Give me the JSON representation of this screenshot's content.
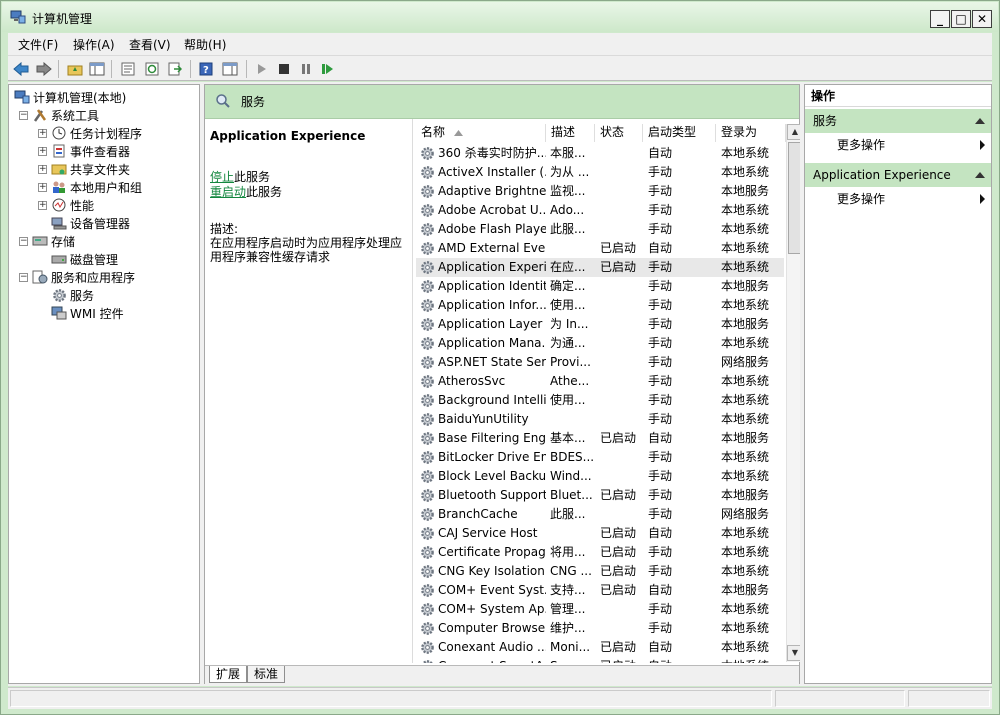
{
  "window": {
    "title": "计算机管理"
  },
  "menu": [
    "文件(F)",
    "操作(A)",
    "查看(V)",
    "帮助(H)"
  ],
  "tree": [
    {
      "label": "计算机管理(本地)",
      "level": 0,
      "icon": "computer-icon",
      "expander": ""
    },
    {
      "label": "系统工具",
      "level": 1,
      "icon": "tools-icon",
      "expander": "⊟"
    },
    {
      "label": "任务计划程序",
      "level": 2,
      "icon": "clock-icon",
      "expander": "+"
    },
    {
      "label": "事件查看器",
      "level": 2,
      "icon": "event-viewer-icon",
      "expander": "+"
    },
    {
      "label": "共享文件夹",
      "level": 2,
      "icon": "shared-folder-icon",
      "expander": "+"
    },
    {
      "label": "本地用户和组",
      "level": 2,
      "icon": "users-icon",
      "expander": "+"
    },
    {
      "label": "性能",
      "level": 2,
      "icon": "performance-icon",
      "expander": "+"
    },
    {
      "label": "设备管理器",
      "level": 2,
      "icon": "device-manager-icon",
      "expander": ""
    },
    {
      "label": "存储",
      "level": 1,
      "icon": "storage-icon",
      "expander": "⊟"
    },
    {
      "label": "磁盘管理",
      "level": 2,
      "icon": "disk-icon",
      "expander": ""
    },
    {
      "label": "服务和应用程序",
      "level": 1,
      "icon": "services-apps-icon",
      "expander": "⊟"
    },
    {
      "label": "服务",
      "level": 2,
      "icon": "gear-icon",
      "expander": ""
    },
    {
      "label": "WMI 控件",
      "level": 2,
      "icon": "wmi-icon",
      "expander": ""
    }
  ],
  "center": {
    "header": "服务",
    "selected_service": "Application Experience",
    "stop_link": "停止",
    "stop_suffix": "此服务",
    "restart_link": "重启动",
    "restart_suffix": "此服务",
    "desc_label": "描述:",
    "desc_text": "在应用程序启动时为应用程序处理应用程序兼容性缓存请求"
  },
  "columns": [
    "名称",
    "描述",
    "状态",
    "启动类型",
    "登录为"
  ],
  "services": [
    [
      "360 杀毒实时防护...",
      "本服...",
      "",
      "自动",
      "本地系统"
    ],
    [
      "ActiveX Installer (...",
      "为从 ...",
      "",
      "手动",
      "本地系统"
    ],
    [
      "Adaptive Brightness",
      "监视...",
      "",
      "手动",
      "本地服务"
    ],
    [
      "Adobe Acrobat U...",
      "Ado...",
      "",
      "手动",
      "本地系统"
    ],
    [
      "Adobe Flash Playe...",
      "此服...",
      "",
      "手动",
      "本地系统"
    ],
    [
      "AMD External Eve...",
      "",
      "已启动",
      "自动",
      "本地系统"
    ],
    [
      "Application Experi...",
      "在应...",
      "已启动",
      "手动",
      "本地系统"
    ],
    [
      "Application Identity",
      "确定...",
      "",
      "手动",
      "本地服务"
    ],
    [
      "Application Infor...",
      "使用...",
      "",
      "手动",
      "本地系统"
    ],
    [
      "Application Layer ...",
      "为 In...",
      "",
      "手动",
      "本地服务"
    ],
    [
      "Application Mana...",
      "为通...",
      "",
      "手动",
      "本地系统"
    ],
    [
      "ASP.NET State Ser...",
      "Provi...",
      "",
      "手动",
      "网络服务"
    ],
    [
      "AtherosSvc",
      "Athe...",
      "",
      "手动",
      "本地系统"
    ],
    [
      "Background Intelli...",
      "使用...",
      "",
      "手动",
      "本地系统"
    ],
    [
      "BaiduYunUtility",
      "",
      "",
      "手动",
      "本地系统"
    ],
    [
      "Base Filtering Engi...",
      "基本...",
      "已启动",
      "自动",
      "本地服务"
    ],
    [
      "BitLocker Drive En...",
      "BDES...",
      "",
      "手动",
      "本地系统"
    ],
    [
      "Block Level Backu...",
      "Wind...",
      "",
      "手动",
      "本地系统"
    ],
    [
      "Bluetooth Support...",
      "Bluet...",
      "已启动",
      "手动",
      "本地服务"
    ],
    [
      "BranchCache",
      "此服...",
      "",
      "手动",
      "网络服务"
    ],
    [
      "CAJ Service Host",
      "",
      "已启动",
      "自动",
      "本地系统"
    ],
    [
      "Certificate Propag...",
      "将用...",
      "已启动",
      "手动",
      "本地系统"
    ],
    [
      "CNG Key Isolation",
      "CNG ...",
      "已启动",
      "手动",
      "本地系统"
    ],
    [
      "COM+ Event Syst...",
      "支持...",
      "已启动",
      "自动",
      "本地服务"
    ],
    [
      "COM+ System Ap...",
      "管理...",
      "",
      "手动",
      "本地系统"
    ],
    [
      "Computer Browser",
      "维护...",
      "",
      "手动",
      "本地系统"
    ],
    [
      "Conexant Audio ...",
      "Moni...",
      "已启动",
      "自动",
      "本地系统"
    ],
    [
      "Conexant SmartA...",
      "Smar...",
      "已启动",
      "自动",
      "本地系统"
    ]
  ],
  "tabs": [
    "扩展",
    "标准"
  ],
  "actions": {
    "title": "操作",
    "section1": "服务",
    "section1_item": "更多操作",
    "section2": "Application Experience",
    "section2_item": "更多操作"
  }
}
